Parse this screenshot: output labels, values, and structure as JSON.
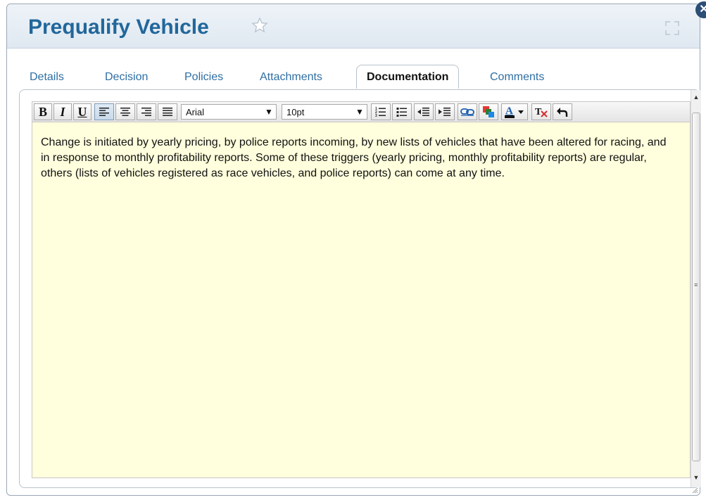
{
  "dialog": {
    "title": "Prequalify Vehicle",
    "close_symbol": "✕"
  },
  "tabs": [
    {
      "label": "Details",
      "active": false
    },
    {
      "label": "Decision",
      "active": false
    },
    {
      "label": "Policies",
      "active": false
    },
    {
      "label": "Attachments",
      "active": false
    },
    {
      "label": "Documentation",
      "active": true
    },
    {
      "label": "Comments",
      "active": false
    }
  ],
  "toolbar": {
    "bold": "B",
    "italic": "I",
    "underline": "U",
    "font_family": "Arial",
    "font_size": "10pt",
    "dropdown_symbol": "▼",
    "icons": [
      "align-left-icon",
      "align-center-icon",
      "align-right-icon",
      "align-justify-icon",
      "numbered-list-icon",
      "bullet-list-icon",
      "outdent-icon",
      "indent-icon",
      "link-icon",
      "background-color-icon",
      "text-color-icon",
      "remove-format-icon",
      "undo-icon"
    ]
  },
  "editor": {
    "text": "Change is initiated by yearly pricing, by police reports incoming, by new lists of vehicles that have been altered for racing, and in response to monthly profitability reports.   Some of these triggers (yearly pricing, monthly profitability reports) are regular, others (lists of vehicles registered as race vehicles, and police reports) can come at any time.",
    "background": "#ffffdd"
  },
  "colors": {
    "title": "#21679b",
    "tab_link": "#2f6ea3",
    "close_button": "#2d4e75"
  }
}
